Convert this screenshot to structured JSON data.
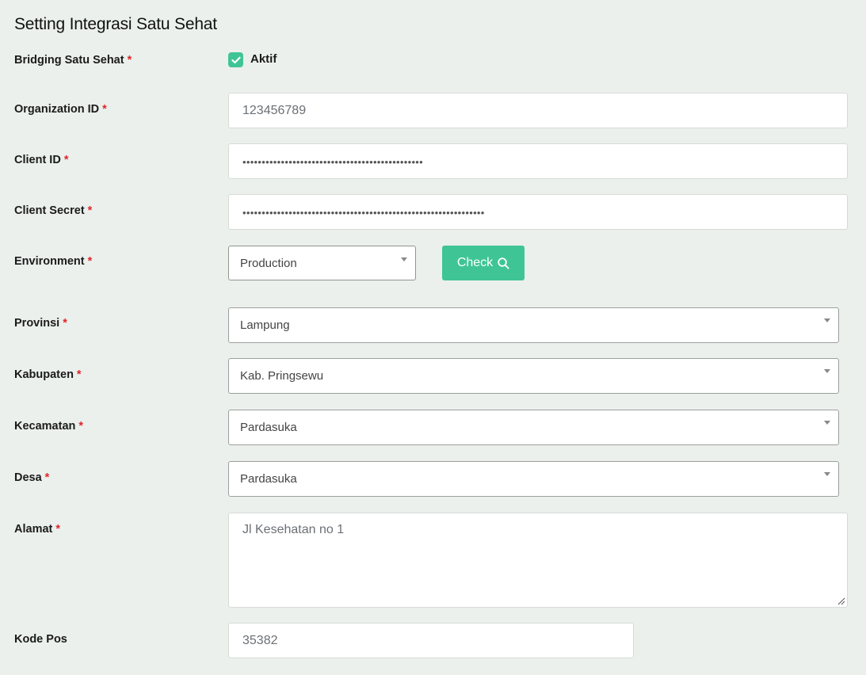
{
  "page": {
    "title": "Setting Integrasi Satu Sehat"
  },
  "required_mark": "*",
  "bridging": {
    "label": "Bridging Satu Sehat",
    "checkbox_label": "Aktif",
    "checked": true
  },
  "organization": {
    "label": "Organization ID",
    "value": "123456789"
  },
  "client_id": {
    "label": "Client ID",
    "value": "•••••••••••••••••••••••••••••••••••••••••••••••"
  },
  "client_secret": {
    "label": "Client Secret",
    "value": "•••••••••••••••••••••••••••••••••••••••••••••••••••••••••••••••"
  },
  "environment": {
    "label": "Environment",
    "selected": "Production",
    "check_button": "Check"
  },
  "provinsi": {
    "label": "Provinsi",
    "selected": "Lampung"
  },
  "kabupaten": {
    "label": "Kabupaten",
    "selected": "Kab. Pringsewu"
  },
  "kecamatan": {
    "label": "Kecamatan",
    "selected": "Pardasuka"
  },
  "desa": {
    "label": "Desa",
    "selected": "Pardasuka"
  },
  "alamat": {
    "label": "Alamat",
    "value": "Jl Kesehatan no 1"
  },
  "kode_pos": {
    "label": "Kode Pos",
    "value": "35382"
  },
  "colors": {
    "accent": "#3fc595",
    "required": "#e0262b",
    "background": "#ebf0ed"
  }
}
